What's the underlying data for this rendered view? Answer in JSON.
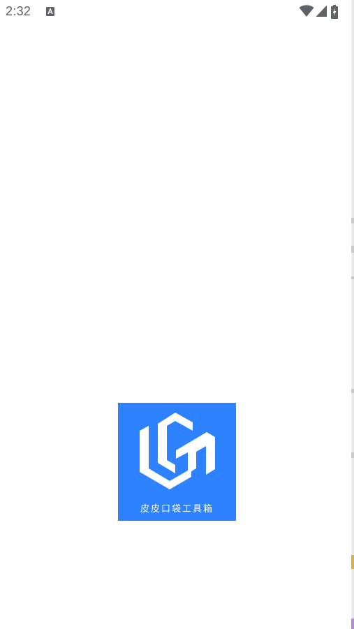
{
  "status_bar": {
    "time": "2:32",
    "notification_icon": "a-letter-notification-icon",
    "wifi_icon": "wifi-icon",
    "signal_icon": "cell-signal-icon",
    "battery_icon": "battery-charging-icon"
  },
  "splash": {
    "logo_icon": "pipi-toolbox-logo-icon",
    "app_name": "皮皮口袋工具箱",
    "brand_color": "#2f82ff"
  }
}
